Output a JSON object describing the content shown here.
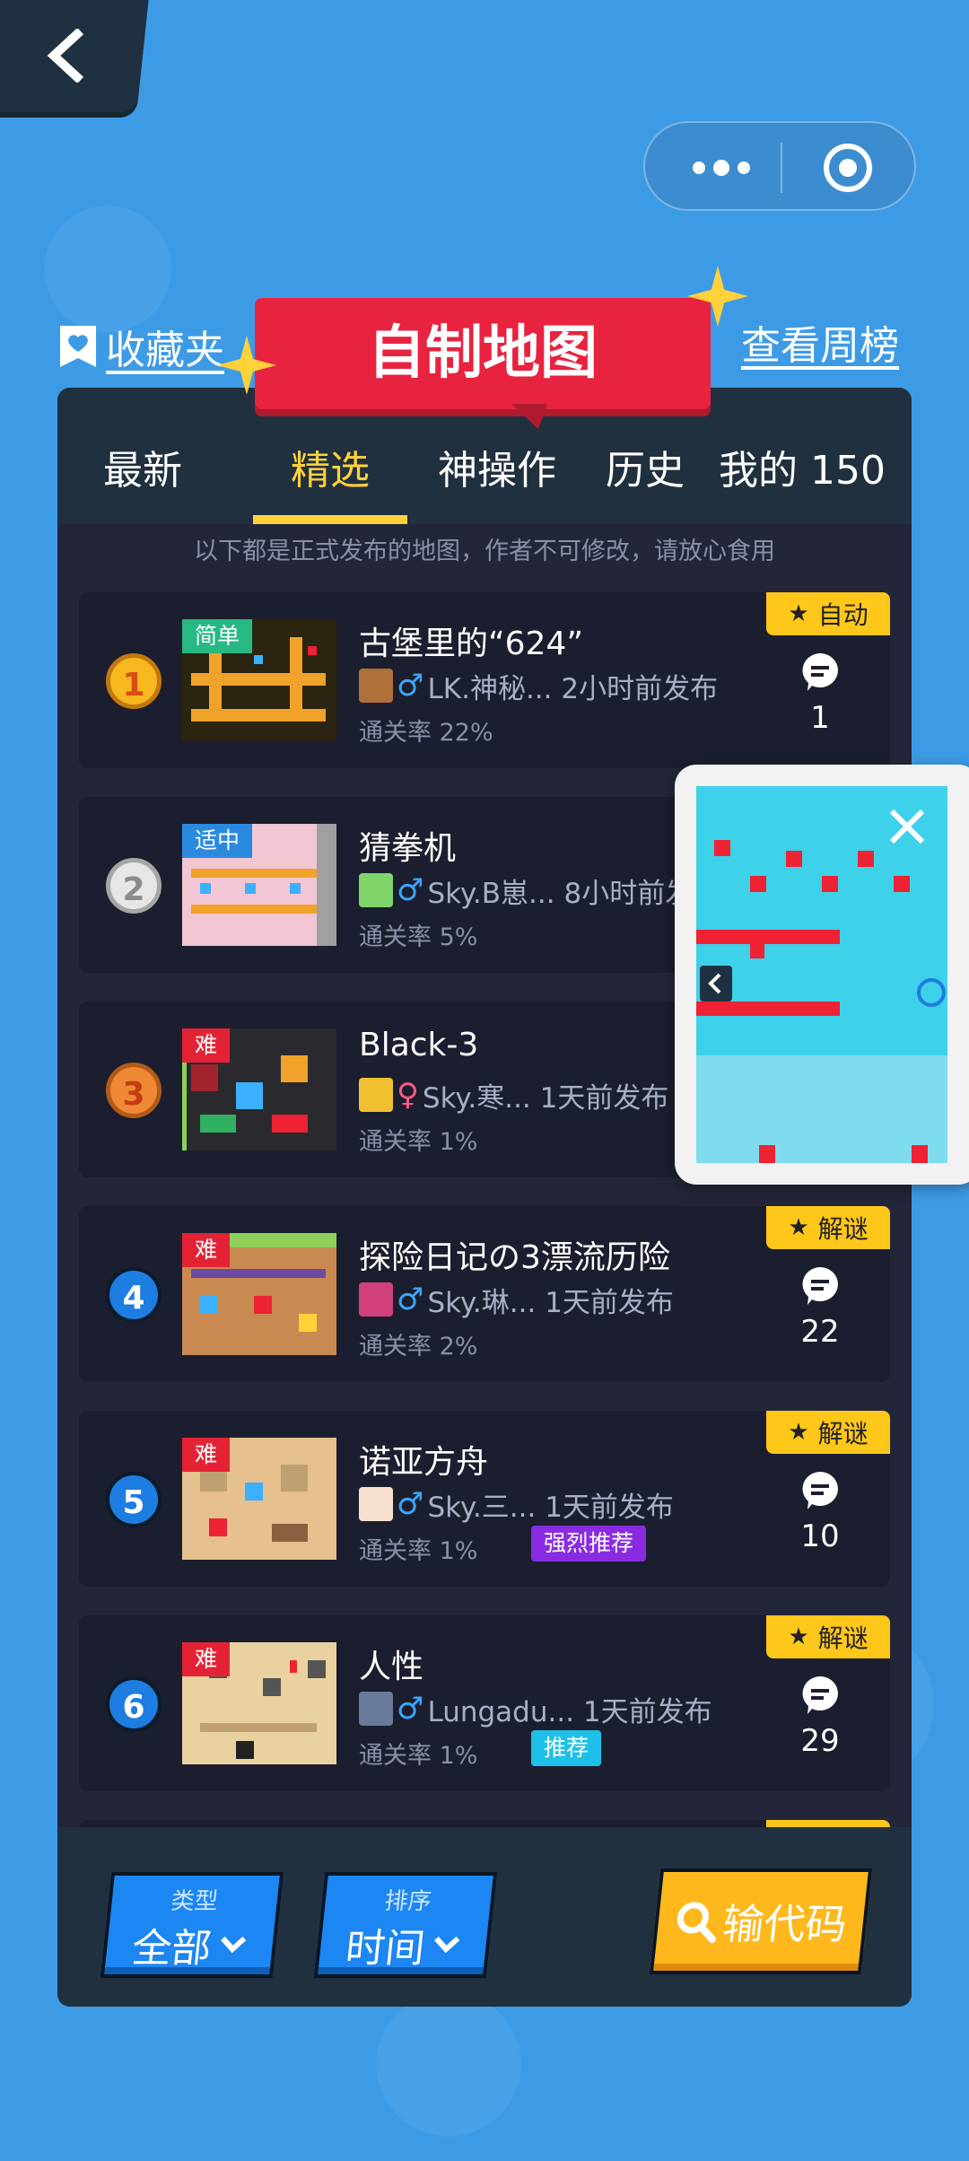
{
  "nav": {
    "back_icon": "chevron-left-icon"
  },
  "capsule": {
    "more_icon": "more-dots-icon",
    "close_icon": "target-circle-icon"
  },
  "header": {
    "favorites_label": "收藏夹",
    "title": "自制地图",
    "weekly_label": "查看周榜"
  },
  "tabs": [
    {
      "label": "最新",
      "active": false
    },
    {
      "label": "精选",
      "active": true
    },
    {
      "label": "神操作",
      "active": false
    },
    {
      "label": "历史",
      "active": false
    },
    {
      "label": "我的 150",
      "active": false
    }
  ],
  "notice": "以下都是正式发布的地图，作者不可修改，请放心食用",
  "items": [
    {
      "rank": "1",
      "difficulty": "简单",
      "title": "古堡里的“624”",
      "gender": "♂",
      "author": "LK.神秘... 2小时前发布",
      "rate": "通关率 22%",
      "tag": "自动",
      "comments": "1",
      "badge": ""
    },
    {
      "rank": "2",
      "difficulty": "适中",
      "title": "猜拳机",
      "gender": "♂",
      "author": "Sky.B崽... 8小时前发",
      "rate": "通关率 5%",
      "tag": "",
      "comments": "",
      "badge": ""
    },
    {
      "rank": "3",
      "difficulty": "难",
      "title": "Black-3",
      "gender": "♀",
      "author": "Sky.寒... 1天前发布",
      "rate": "通关率 1%",
      "tag": "",
      "comments": "",
      "badge": ""
    },
    {
      "rank": "4",
      "difficulty": "难",
      "title": "探险日记の3漂流历险",
      "gender": "♂",
      "author": "Sky.琳... 1天前发布",
      "rate": "通关率 2%",
      "tag": "解谜",
      "comments": "22",
      "badge": ""
    },
    {
      "rank": "5",
      "difficulty": "难",
      "title": "诺亚方舟",
      "gender": "♂",
      "author": "Sky.三... 1天前发布",
      "rate": "通关率 1%",
      "tag": "解谜",
      "comments": "10",
      "badge": "强烈推荐"
    },
    {
      "rank": "6",
      "difficulty": "难",
      "title": "人性",
      "gender": "♂",
      "author": "Lungadu... 1天前发布",
      "rate": "通关率 1%",
      "tag": "解谜",
      "comments": "29",
      "badge": "推荐"
    }
  ],
  "bottom": {
    "type_label": "类型",
    "type_value": "全部",
    "sort_label": "排序",
    "sort_value": "时间",
    "code_label": "输代码"
  },
  "colors": {
    "background": "#3d9be6",
    "panel": "#232638",
    "accent_yellow": "#ffd23a",
    "title_red": "#e8233f",
    "button_blue": "#1c86f2",
    "button_orange": "#ffb81c"
  }
}
